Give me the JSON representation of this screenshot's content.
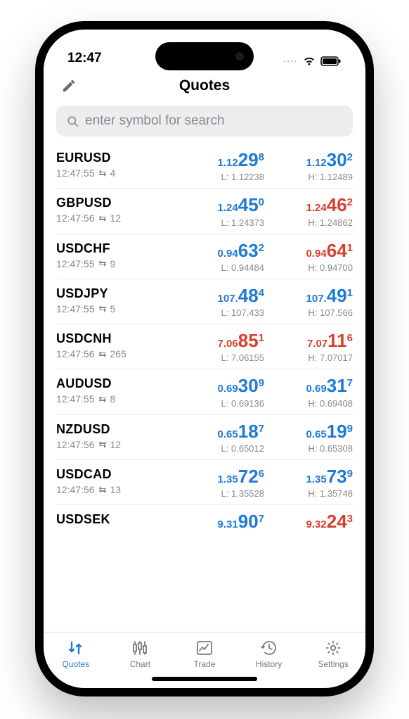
{
  "status": {
    "time": "12:47"
  },
  "header": {
    "title": "Quotes"
  },
  "search": {
    "placeholder": "enter symbol for search"
  },
  "labels": {
    "low_prefix": "L: ",
    "high_prefix": "H: "
  },
  "quotes": [
    {
      "symbol": "EURUSD",
      "time": "12:47:55",
      "spread": "4",
      "bid": {
        "base": "1.12",
        "big": "29",
        "pip": "8",
        "color": "blue"
      },
      "ask": {
        "base": "1.12",
        "big": "30",
        "pip": "2",
        "color": "blue"
      },
      "low": "1.12238",
      "high": "1.12489"
    },
    {
      "symbol": "GBPUSD",
      "time": "12:47:56",
      "spread": "12",
      "bid": {
        "base": "1.24",
        "big": "45",
        "pip": "0",
        "color": "blue"
      },
      "ask": {
        "base": "1.24",
        "big": "46",
        "pip": "2",
        "color": "red"
      },
      "low": "1.24373",
      "high": "1.24862"
    },
    {
      "symbol": "USDCHF",
      "time": "12:47:55",
      "spread": "9",
      "bid": {
        "base": "0.94",
        "big": "63",
        "pip": "2",
        "color": "blue"
      },
      "ask": {
        "base": "0.94",
        "big": "64",
        "pip": "1",
        "color": "red"
      },
      "low": "0.94484",
      "high": "0.94700"
    },
    {
      "symbol": "USDJPY",
      "time": "12:47:55",
      "spread": "5",
      "bid": {
        "base": "107.",
        "big": "48",
        "pip": "4",
        "color": "blue"
      },
      "ask": {
        "base": "107.",
        "big": "49",
        "pip": "1",
        "color": "blue"
      },
      "low": "107.433",
      "high": "107.566"
    },
    {
      "symbol": "USDCNH",
      "time": "12:47:56",
      "spread": "265",
      "bid": {
        "base": "7.06",
        "big": "85",
        "pip": "1",
        "color": "red"
      },
      "ask": {
        "base": "7.07",
        "big": "11",
        "pip": "6",
        "color": "red"
      },
      "low": "7.06155",
      "high": "7.07017"
    },
    {
      "symbol": "AUDUSD",
      "time": "12:47:55",
      "spread": "8",
      "bid": {
        "base": "0.69",
        "big": "30",
        "pip": "9",
        "color": "blue"
      },
      "ask": {
        "base": "0.69",
        "big": "31",
        "pip": "7",
        "color": "blue"
      },
      "low": "0.69136",
      "high": "0.69408"
    },
    {
      "symbol": "NZDUSD",
      "time": "12:47:56",
      "spread": "12",
      "bid": {
        "base": "0.65",
        "big": "18",
        "pip": "7",
        "color": "blue"
      },
      "ask": {
        "base": "0.65",
        "big": "19",
        "pip": "9",
        "color": "blue"
      },
      "low": "0.65012",
      "high": "0.65308"
    },
    {
      "symbol": "USDCAD",
      "time": "12:47:56",
      "spread": "13",
      "bid": {
        "base": "1.35",
        "big": "72",
        "pip": "6",
        "color": "blue"
      },
      "ask": {
        "base": "1.35",
        "big": "73",
        "pip": "9",
        "color": "blue"
      },
      "low": "1.35528",
      "high": "1.35748"
    },
    {
      "symbol": "USDSEK",
      "time": "",
      "spread": "",
      "bid": {
        "base": "9.31",
        "big": "90",
        "pip": "7",
        "color": "blue"
      },
      "ask": {
        "base": "9.32",
        "big": "24",
        "pip": "3",
        "color": "red"
      },
      "low": "",
      "high": ""
    }
  ],
  "tabs": [
    {
      "id": "quotes",
      "label": "Quotes",
      "active": true
    },
    {
      "id": "chart",
      "label": "Chart",
      "active": false
    },
    {
      "id": "trade",
      "label": "Trade",
      "active": false
    },
    {
      "id": "history",
      "label": "History",
      "active": false
    },
    {
      "id": "settings",
      "label": "Settings",
      "active": false
    }
  ]
}
